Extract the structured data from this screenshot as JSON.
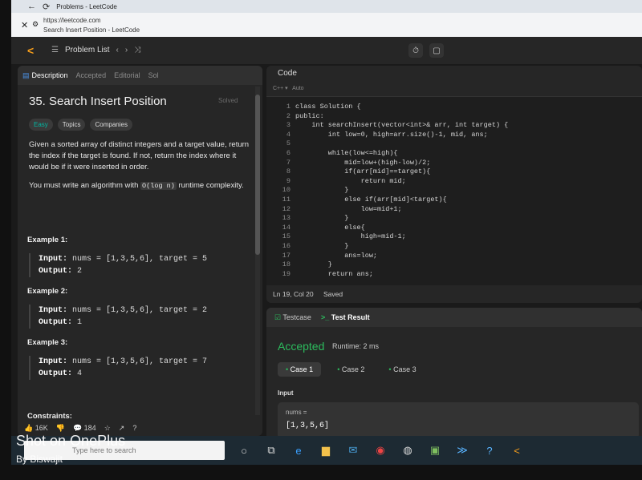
{
  "browser": {
    "tab_title": "Problems - LeetCode",
    "url": "https://leetcode.com",
    "page_title": "Search Insert Position - LeetCode"
  },
  "topbar": {
    "problem_list": "Problem List"
  },
  "left_panel": {
    "tabs": [
      "Description",
      "Accepted",
      "Editorial",
      "Sol"
    ],
    "title": "35. Search Insert Position",
    "solved": "Solved",
    "badges": [
      "Easy",
      "Topics",
      "Companies"
    ],
    "desc_p1": "Given a sorted array of distinct integers and a target value, return the index if the target is found. If not, return the index where it would be if it were inserted in order.",
    "desc_p2_a": "You must write an algorithm with",
    "desc_p2_code": "O(log n)",
    "desc_p2_b": "runtime complexity.",
    "examples": [
      {
        "title": "Example 1:",
        "input": "nums = [1,3,5,6], target = 5",
        "output": "2"
      },
      {
        "title": "Example 2:",
        "input": "nums = [1,3,5,6], target = 2",
        "output": "1"
      },
      {
        "title": "Example 3:",
        "input": "nums = [1,3,5,6], target = 7",
        "output": "4"
      }
    ],
    "input_label": "Input:",
    "output_label": "Output:",
    "constraints": "Constraints:",
    "likes": "16K",
    "comments": "184"
  },
  "code_panel": {
    "title": "Code",
    "lang": "C++",
    "auto": "Auto",
    "lines": [
      {
        "n": "1",
        "t": "class Solution {"
      },
      {
        "n": "2",
        "t": "public:"
      },
      {
        "n": "3",
        "t": "    int searchInsert(vector<int>& arr, int target) {"
      },
      {
        "n": "4",
        "t": "        int low=0, high=arr.size()-1, mid, ans;"
      },
      {
        "n": "5",
        "t": ""
      },
      {
        "n": "6",
        "t": "        while(low<=high){"
      },
      {
        "n": "7",
        "t": "            mid=low+(high-low)/2;"
      },
      {
        "n": "8",
        "t": "            if(arr[mid]==target){"
      },
      {
        "n": "9",
        "t": "                return mid;"
      },
      {
        "n": "10",
        "t": "            }"
      },
      {
        "n": "11",
        "t": "            else if(arr[mid]<target){"
      },
      {
        "n": "12",
        "t": "                low=mid+1;"
      },
      {
        "n": "13",
        "t": "            }"
      },
      {
        "n": "14",
        "t": "            else{"
      },
      {
        "n": "15",
        "t": "                high=mid-1;"
      },
      {
        "n": "16",
        "t": "            }"
      },
      {
        "n": "17",
        "t": "            ans=low;"
      },
      {
        "n": "18",
        "t": "        }"
      },
      {
        "n": "19",
        "t": "        return ans;"
      }
    ],
    "cursor": "Ln 19, Col 20",
    "saved": "Saved"
  },
  "result_panel": {
    "tab_testcase": "Testcase",
    "tab_result": "Test Result",
    "status": "Accepted",
    "runtime": "Runtime: 2 ms",
    "cases": [
      "Case 1",
      "Case 2",
      "Case 3"
    ],
    "input_label": "Input",
    "var_name": "nums =",
    "var_value": "[1,3,5,6]"
  },
  "taskbar": {
    "search_placeholder": "Type here to search"
  },
  "watermark": {
    "line1": "Shot on OnePlus",
    "line2": "By Biswajit"
  },
  "colors": {
    "accepted": "#2cbb5d",
    "easy": "#00b8a3",
    "brand": "#f89f1b"
  }
}
